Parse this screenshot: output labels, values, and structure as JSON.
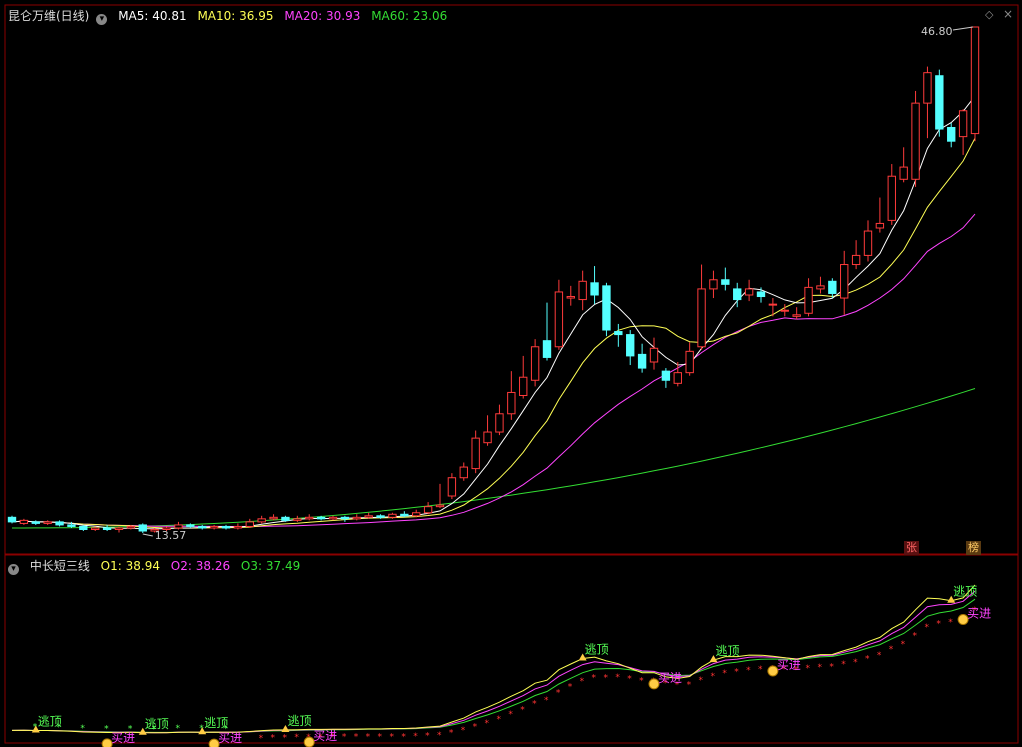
{
  "main_panel": {
    "stock_name": "昆仑万维(日线)",
    "ma_labels": [
      {
        "text": "MA5: 40.81",
        "color": "#ffffff"
      },
      {
        "text": "MA10: 36.95",
        "color": "#ffff55"
      },
      {
        "text": "MA20: 30.93",
        "color": "#ff44ff"
      },
      {
        "text": "MA60: 23.06",
        "color": "#33dd33"
      }
    ],
    "high_label": "46.80",
    "low_label": "13.57",
    "badges": [
      {
        "text": "张",
        "color": "#ff6666",
        "bg": "#5a1111"
      },
      {
        "text": "榜",
        "color": "#ffcc66",
        "bg": "#5a3a11"
      }
    ]
  },
  "sub_panel": {
    "title": "中长短三线",
    "labels": [
      {
        "text": "O1: 38.94",
        "color": "#ffff55"
      },
      {
        "text": "O2: 38.26",
        "color": "#ff44ff"
      },
      {
        "text": "O3: 37.49",
        "color": "#33dd33"
      }
    ],
    "signal_escape": "逃顶",
    "signal_buy": "买进"
  },
  "colors": {
    "up": "#ff3b3b",
    "down": "#54ffff",
    "ma5": "#ffffff",
    "ma10": "#ffff55",
    "ma20": "#ff44ff",
    "ma60": "#33dd33",
    "frame": "#8b0000",
    "signal_green": "#55ff55",
    "signal_magenta": "#ff44ff"
  },
  "chart_data": {
    "type": "candlestick",
    "ylim": [
      13.57,
      46.8
    ],
    "candles": [
      [
        14.6,
        14.3,
        14.7,
        14.2
      ],
      [
        14.2,
        14.4,
        14.5,
        14.1
      ],
      [
        14.3,
        14.2,
        14.4,
        14.1
      ],
      [
        14.2,
        14.3,
        14.4,
        14.1
      ],
      [
        14.3,
        14.1,
        14.4,
        14.0
      ],
      [
        14.1,
        14.0,
        14.3,
        13.9
      ],
      [
        14.0,
        13.8,
        14.1,
        13.7
      ],
      [
        13.8,
        13.9,
        14.0,
        13.7
      ],
      [
        13.9,
        13.8,
        14.1,
        13.7
      ],
      [
        13.8,
        13.9,
        14.0,
        13.6
      ],
      [
        13.9,
        14.0,
        14.1,
        13.8
      ],
      [
        14.1,
        13.7,
        14.2,
        13.57
      ],
      [
        13.7,
        13.8,
        13.9,
        13.6
      ],
      [
        13.8,
        13.9,
        14.0,
        13.7
      ],
      [
        13.9,
        14.1,
        14.3,
        13.8
      ],
      [
        14.1,
        14.0,
        14.2,
        13.9
      ],
      [
        14.0,
        13.9,
        14.1,
        13.8
      ],
      [
        13.9,
        14.0,
        14.1,
        13.8
      ],
      [
        14.0,
        13.9,
        14.1,
        13.8
      ],
      [
        13.9,
        14.0,
        14.2,
        13.8
      ],
      [
        14.0,
        14.3,
        14.5,
        13.9
      ],
      [
        14.3,
        14.5,
        14.7,
        14.2
      ],
      [
        14.5,
        14.6,
        14.8,
        14.4
      ],
      [
        14.6,
        14.4,
        14.7,
        14.3
      ],
      [
        14.4,
        14.5,
        14.7,
        14.3
      ],
      [
        14.5,
        14.6,
        14.8,
        14.4
      ],
      [
        14.6,
        14.5,
        14.7,
        14.4
      ],
      [
        14.5,
        14.6,
        14.7,
        14.4
      ],
      [
        14.6,
        14.5,
        14.7,
        14.3
      ],
      [
        14.5,
        14.6,
        14.8,
        14.4
      ],
      [
        14.6,
        14.7,
        14.9,
        14.5
      ],
      [
        14.7,
        14.6,
        14.8,
        14.5
      ],
      [
        14.6,
        14.8,
        14.9,
        14.5
      ],
      [
        14.8,
        14.7,
        15.0,
        14.6
      ],
      [
        14.7,
        14.9,
        15.1,
        14.6
      ],
      [
        14.9,
        15.3,
        15.6,
        14.8
      ],
      [
        15.3,
        15.4,
        16.8,
        15.2
      ],
      [
        16.0,
        17.2,
        17.5,
        15.8
      ],
      [
        17.2,
        17.9,
        18.2,
        17.0
      ],
      [
        17.8,
        19.8,
        20.3,
        17.5
      ],
      [
        19.5,
        20.2,
        21.3,
        19.3
      ],
      [
        20.2,
        21.4,
        22.0,
        20.0
      ],
      [
        21.4,
        22.8,
        24.2,
        21.0
      ],
      [
        22.6,
        23.8,
        25.2,
        22.4
      ],
      [
        23.6,
        25.8,
        26.3,
        23.2
      ],
      [
        26.2,
        25.1,
        28.7,
        24.9
      ],
      [
        25.8,
        29.4,
        30.2,
        25.6
      ],
      [
        29.0,
        29.1,
        29.8,
        28.5
      ],
      [
        28.9,
        30.1,
        30.8,
        28.2
      ],
      [
        30.0,
        29.2,
        31.1,
        28.6
      ],
      [
        29.8,
        26.9,
        30.0,
        26.5
      ],
      [
        26.8,
        26.6,
        27.3,
        25.8
      ],
      [
        26.6,
        25.2,
        26.9,
        24.6
      ],
      [
        25.3,
        24.4,
        26.0,
        24.1
      ],
      [
        24.8,
        25.7,
        26.4,
        24.3
      ],
      [
        24.2,
        23.6,
        24.4,
        23.1
      ],
      [
        23.4,
        24.1,
        24.8,
        23.2
      ],
      [
        24.1,
        25.5,
        26.1,
        23.9
      ],
      [
        25.8,
        29.6,
        31.2,
        25.6
      ],
      [
        29.6,
        30.2,
        30.8,
        29.0
      ],
      [
        30.2,
        29.9,
        31.0,
        29.5
      ],
      [
        29.6,
        28.9,
        30.0,
        28.4
      ],
      [
        29.2,
        29.6,
        30.2,
        28.8
      ],
      [
        29.4,
        29.1,
        29.7,
        28.7
      ],
      [
        28.6,
        28.6,
        29.0,
        27.8
      ],
      [
        28.2,
        28.2,
        28.6,
        27.8
      ],
      [
        27.8,
        27.9,
        28.4,
        27.6
      ],
      [
        28.0,
        29.7,
        30.3,
        27.8
      ],
      [
        29.6,
        29.8,
        30.4,
        29.3
      ],
      [
        30.1,
        29.3,
        30.3,
        29.0
      ],
      [
        29.0,
        31.2,
        32.1,
        27.9
      ],
      [
        31.2,
        31.8,
        32.8,
        30.9
      ],
      [
        31.8,
        33.4,
        34.1,
        31.4
      ],
      [
        33.6,
        33.9,
        35.6,
        33.3
      ],
      [
        34.1,
        37.0,
        37.8,
        33.8
      ],
      [
        36.8,
        37.6,
        38.9,
        36.6
      ],
      [
        36.8,
        41.8,
        42.6,
        36.3
      ],
      [
        41.8,
        43.8,
        44.2,
        39.5
      ],
      [
        43.6,
        40.1,
        44.0,
        39.6
      ],
      [
        40.2,
        39.3,
        40.5,
        38.9
      ],
      [
        39.6,
        41.3,
        41.4,
        38.4
      ],
      [
        39.8,
        46.8,
        46.8,
        39.3
      ]
    ],
    "ma60_end": 23.06
  }
}
